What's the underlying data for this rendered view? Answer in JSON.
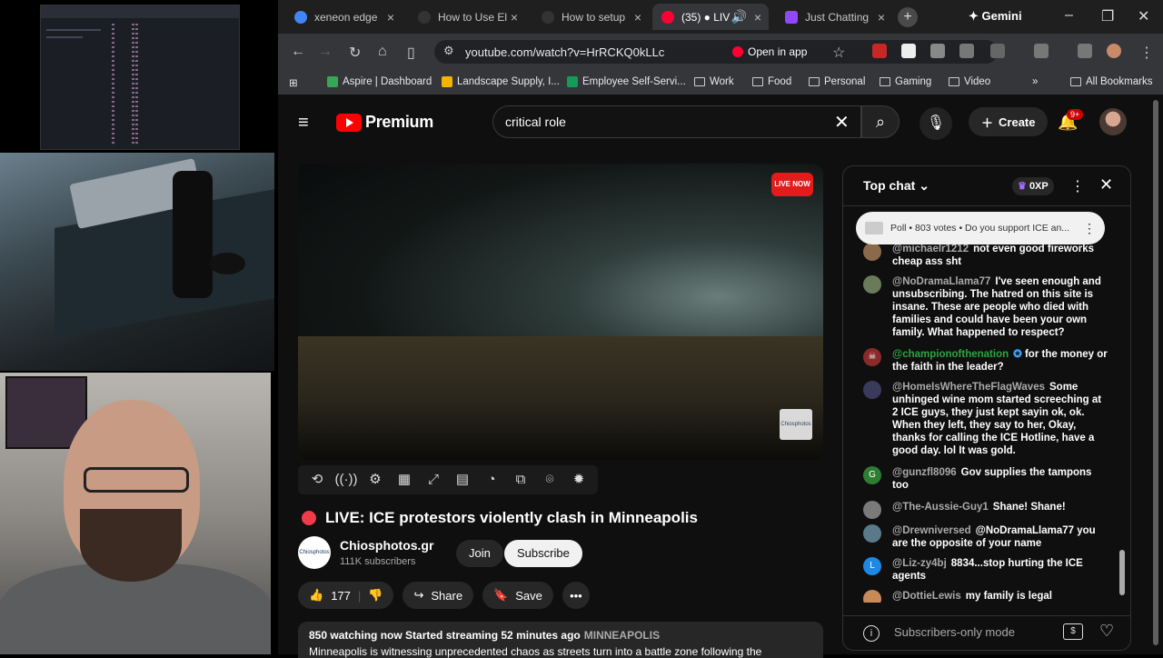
{
  "tabs": [
    {
      "label": "xeneon edge",
      "color": "#4285f4"
    },
    {
      "label": "How to Use El",
      "color": "#222"
    },
    {
      "label": "How to setup",
      "color": "#222"
    },
    {
      "label": "(35) ● LIV",
      "color": "#ff0033",
      "active": true
    },
    {
      "label": "Just Chatting",
      "color": "#9146ff"
    }
  ],
  "browser": {
    "new_tab": "+",
    "gemini": "✦ Gemini",
    "url": "youtube.com/watch?v=HrRCKQ0kLLc",
    "open_in_app": "Open in app"
  },
  "bookmarks": [
    {
      "label": "Aspire | Dashboard",
      "type": "site",
      "color": "#34a853"
    },
    {
      "label": "Landscape Supply, I...",
      "type": "site",
      "color": "#f4b400"
    },
    {
      "label": "Employee Self-Servi...",
      "type": "site",
      "color": "#0f9d58"
    },
    {
      "label": "Work",
      "type": "folder"
    },
    {
      "label": "Food",
      "type": "folder"
    },
    {
      "label": "Personal",
      "type": "folder"
    },
    {
      "label": "Gaming",
      "type": "folder"
    },
    {
      "label": "Video",
      "type": "folder"
    },
    {
      "label": "All Bookmarks",
      "type": "folder"
    }
  ],
  "yt": {
    "logo_text": "Premium",
    "search_value": "critical role",
    "create_label": "Create",
    "notif_badge": "9+"
  },
  "video": {
    "live_badge": "LIVE NOW",
    "watermark": "Chiosphotos",
    "title": "LIVE: ICE protestors violently clash in Minneapolis",
    "channel_name": "Chiosphotos.gr",
    "channel_subs": "111K subscribers",
    "channel_avatar_text": "Chiosphotos",
    "join_label": "Join",
    "subscribe_label": "Subscribe",
    "likes": "177",
    "share_label": "Share",
    "save_label": "Save",
    "desc_meta": "850 watching now  Started streaming 52 minutes ago",
    "desc_tag": "MINNEAPOLIS",
    "desc_snippet": "Minneapolis is witnessing unprecedented chaos as streets turn into a battle zone following the"
  },
  "chat": {
    "header": "Top chat",
    "xp": "0XP",
    "poll_text": "Poll • 803 votes • Do you support ICE an...",
    "footer_text": "Subscribers-only mode",
    "messages": [
      {
        "author": "@michaelr1212",
        "text": "not even good fireworks cheap ass sht",
        "avatar": "#8a6a4a",
        "initial": ""
      },
      {
        "author": "@NoDramaLlama77",
        "text": "I've seen enough and unsubscribing. The hatred on this site is insane. These are people who died with families and could have been your own family. What happened to respect?",
        "avatar": "#6b7a5a",
        "initial": ""
      },
      {
        "author": "@championofthenation",
        "text": "for the money or the faith in the leader?",
        "avatar": "#8a2a2a",
        "initial": "☠",
        "mod": true
      },
      {
        "author": "@HomeIsWhereTheFlagWaves",
        "text": "Some unhinged wine mom started screeching at 2 ICE guys, they just kept sayin ok, ok. When they left, they say to her, Okay, thanks for calling the ICE Hotline, have a good day. lol It was gold.",
        "avatar": "#3a3a5a",
        "initial": ""
      },
      {
        "author": "@gunzfl8096",
        "text": "Gov supplies the tampons too",
        "avatar": "#2e7d32",
        "initial": "G"
      },
      {
        "author": "@The-Aussie-Guy1",
        "text": "Shane! Shane!",
        "avatar": "#7a7a7a",
        "initial": ""
      },
      {
        "author": "@Drewniversed",
        "text": "@NoDramaLlama77 you are the opposite of your name",
        "avatar": "#5a7a8a",
        "initial": ""
      },
      {
        "author": "@Liz-zy4bj",
        "text": "8834...stop hurting the ICE agents",
        "avatar": "#1e88e5",
        "initial": "L"
      },
      {
        "author": "@DottieLewis",
        "text": "my family is legal",
        "avatar": "#c98a5a",
        "initial": ""
      }
    ]
  }
}
